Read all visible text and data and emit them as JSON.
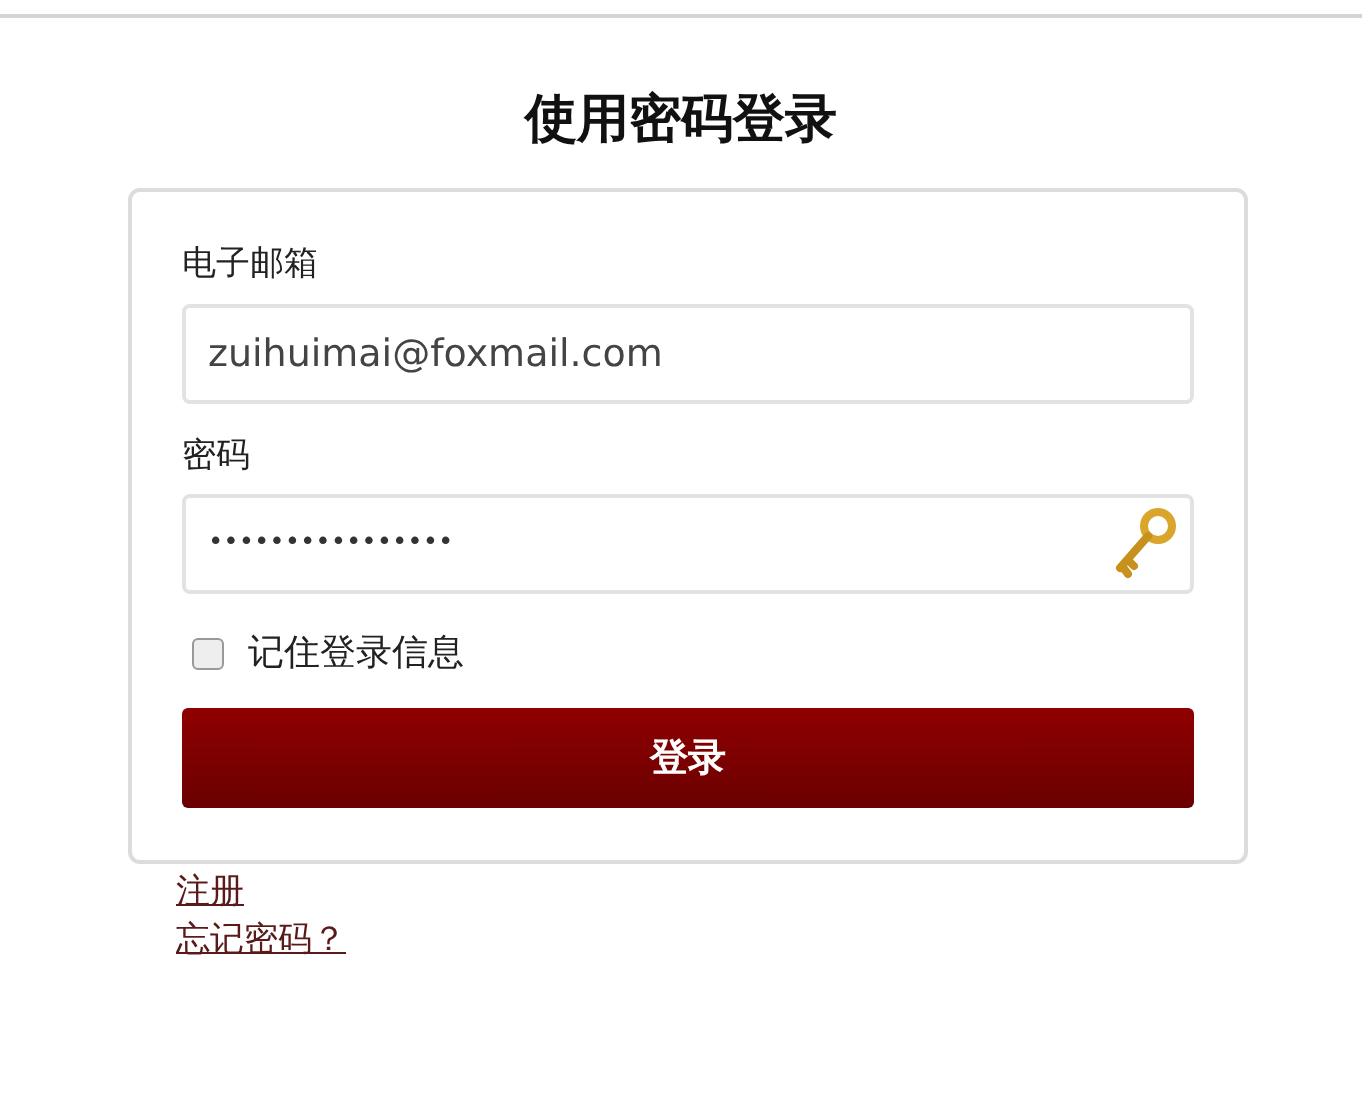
{
  "title": "使用密码登录",
  "form": {
    "email": {
      "label": "电子邮箱",
      "value": "zuihuimai@foxmail.com"
    },
    "password": {
      "label": "密码",
      "value": "••••••••••••••••"
    },
    "remember": {
      "label": "记住登录信息",
      "checked": false
    },
    "submit": "登录"
  },
  "links": [
    {
      "label": "注册"
    },
    {
      "label": "忘记密码？"
    }
  ]
}
